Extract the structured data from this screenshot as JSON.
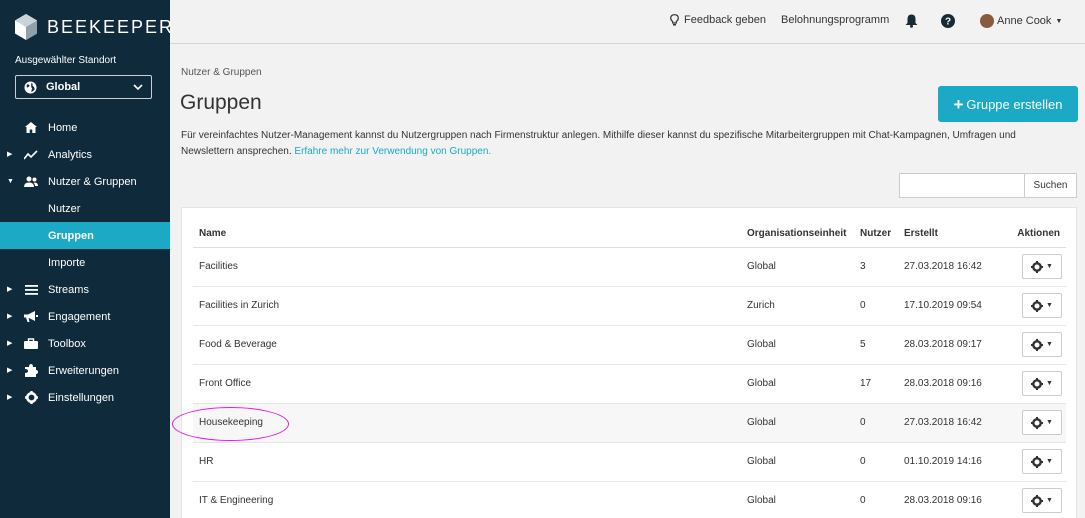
{
  "brand": {
    "name": "BEEKEEPER"
  },
  "sidebar": {
    "location_label": "Ausgewählter Standort",
    "location_value": "Global",
    "items": [
      {
        "label": "Home",
        "icon": "home-icon"
      },
      {
        "label": "Analytics",
        "icon": "analytics-icon"
      },
      {
        "label": "Nutzer & Gruppen",
        "icon": "users-icon"
      },
      {
        "label": "Nutzer"
      },
      {
        "label": "Gruppen"
      },
      {
        "label": "Importe"
      },
      {
        "label": "Streams",
        "icon": "streams-icon"
      },
      {
        "label": "Engagement",
        "icon": "megaphone-icon"
      },
      {
        "label": "Toolbox",
        "icon": "toolbox-icon"
      },
      {
        "label": "Erweiterungen",
        "icon": "puzzle-icon"
      },
      {
        "label": "Einstellungen",
        "icon": "gear-icon"
      }
    ]
  },
  "topbar": {
    "feedback": "Feedback geben",
    "rewards": "Belohnungsprogramm",
    "user": "Anne Cook"
  },
  "main": {
    "breadcrumb": "Nutzer & Gruppen",
    "title": "Gruppen",
    "create_button": "Gruppe erstellen",
    "description": "Für vereinfachtes Nutzer-Management kannst du Nutzergruppen nach Firmenstruktur anlegen. Mithilfe dieser kannst du spezifische Mitarbeitergruppen mit Chat-Kampagnen, Umfragen und Newslettern ansprechen.",
    "description_link": "Erfahre mehr zur Verwendung von Gruppen.",
    "search_button": "Suchen",
    "search_value": ""
  },
  "table": {
    "headers": {
      "name": "Name",
      "org": "Organisationseinheit",
      "users": "Nutzer",
      "created": "Erstellt",
      "actions": "Aktionen"
    },
    "rows": [
      {
        "name": "Facilities",
        "org": "Global",
        "users": "3",
        "created": "27.03.2018 16:42"
      },
      {
        "name": "Facilities in Zurich",
        "org": "Zurich",
        "users": "0",
        "created": "17.10.2019 09:54"
      },
      {
        "name": "Food & Beverage",
        "org": "Global",
        "users": "5",
        "created": "28.03.2018 09:17"
      },
      {
        "name": "Front Office",
        "org": "Global",
        "users": "17",
        "created": "28.03.2018 09:16"
      },
      {
        "name": "Housekeeping",
        "org": "Global",
        "users": "0",
        "created": "27.03.2018 16:42"
      },
      {
        "name": "HR",
        "org": "Global",
        "users": "0",
        "created": "01.10.2019 14:16"
      },
      {
        "name": "IT & Engineering",
        "org": "Global",
        "users": "0",
        "created": "28.03.2018 09:16"
      }
    ]
  },
  "colors": {
    "sidebar_bg": "#0f2a3a",
    "accent": "#1ba9c6",
    "annotation": "#e21be2"
  }
}
